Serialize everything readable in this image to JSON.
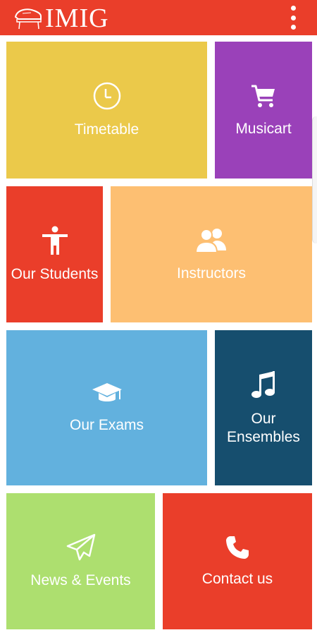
{
  "header": {
    "logo_text": "IMIG",
    "background_color": "#ea3e2a",
    "menu_icon": "overflow-menu-icon"
  },
  "tiles": [
    {
      "label": "Timetable",
      "icon": "clock-icon",
      "color": "#ebc94a"
    },
    {
      "label": "Musicart",
      "icon": "shopping-cart-icon",
      "color": "#9a41b9"
    },
    {
      "label": "Our Students",
      "icon": "person-icon",
      "color": "#ea3e2a"
    },
    {
      "label": "Instructors",
      "icon": "group-icon",
      "color": "#fdbf72"
    },
    {
      "label": "Our Exams",
      "icon": "graduation-cap-icon",
      "color": "#62b1de"
    },
    {
      "label": "Our\nEnsembles",
      "icon": "music-note-icon",
      "color": "#164e6e"
    },
    {
      "label": "News & Events",
      "icon": "paper-plane-icon",
      "color": "#addf6f"
    },
    {
      "label": "Contact us",
      "icon": "phone-icon",
      "color": "#ea3e2a"
    }
  ]
}
